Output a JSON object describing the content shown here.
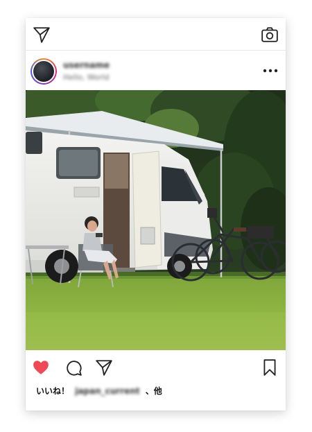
{
  "post": {
    "username": "username",
    "subtitle": "Hello, World",
    "likes_prefix": "いいね！",
    "liked_by": "japan_current",
    "likes_suffix": "、他"
  },
  "icons": {
    "top_left": "send-icon",
    "top_right": "camera-icon",
    "header_right": "more-icon",
    "actions": [
      "heart-icon",
      "comment-icon",
      "send-icon",
      "bookmark-icon"
    ]
  },
  "colors": {
    "heart": "#ed4956",
    "avatar_ring": [
      "#f58529",
      "#dd2a7b",
      "#8134af",
      "#515bd4"
    ]
  }
}
